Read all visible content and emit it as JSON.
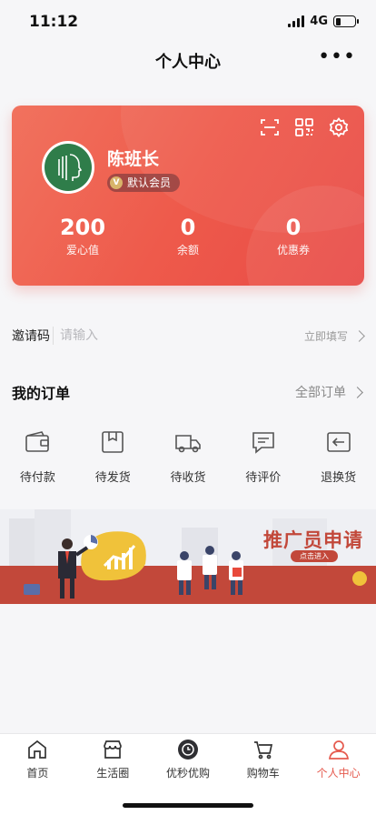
{
  "status": {
    "time": "11:12",
    "network": "4G"
  },
  "nav": {
    "title": "个人中心"
  },
  "profile": {
    "name": "陈班长",
    "member_level": "默认会员",
    "stats": [
      {
        "value": "200",
        "label": "爱心值"
      },
      {
        "value": "0",
        "label": "余额"
      },
      {
        "value": "0",
        "label": "优惠券"
      }
    ]
  },
  "invite": {
    "label": "邀请码",
    "placeholder": "请输入",
    "action": "立即填写"
  },
  "orders": {
    "title": "我的订单",
    "all_label": "全部订单",
    "items": [
      {
        "label": "待付款",
        "icon": "wallet-icon"
      },
      {
        "label": "待发货",
        "icon": "package-icon"
      },
      {
        "label": "待收货",
        "icon": "truck-icon"
      },
      {
        "label": "待评价",
        "icon": "comment-icon"
      },
      {
        "label": "退换货",
        "icon": "return-icon"
      }
    ]
  },
  "banner": {
    "title": "推广员申请",
    "button": "点击进入"
  },
  "tabbar": {
    "items": [
      {
        "label": "首页",
        "icon": "home-icon"
      },
      {
        "label": "生活圈",
        "icon": "shop-icon"
      },
      {
        "label": "优秒优购",
        "icon": "clock-icon"
      },
      {
        "label": "购物车",
        "icon": "cart-icon"
      },
      {
        "label": "个人中心",
        "icon": "user-icon",
        "active": true
      }
    ]
  },
  "colors": {
    "accent": "#e55a4e",
    "card_start": "#f1725e",
    "card_end": "#e84a46"
  }
}
